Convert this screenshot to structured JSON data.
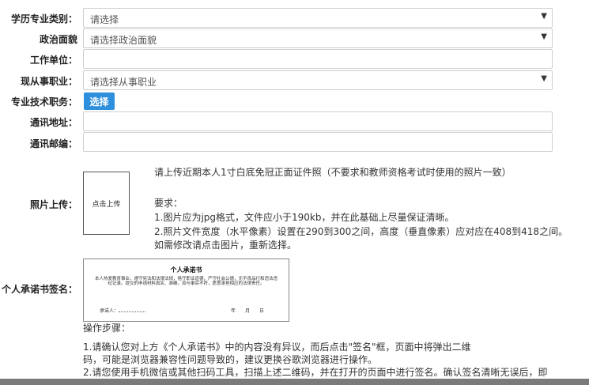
{
  "form": {
    "education_label": "学历专业类别：",
    "education_value": "请选择",
    "political_label": "政治面貌",
    "political_value": "请选择政治面貌",
    "workplace_label": "工作单位：",
    "workplace_value": "",
    "occupation_label": "现从事职业：",
    "occupation_value": "请选择从事职业",
    "title_label": "专业技术职务：",
    "title_button": "选择",
    "address_label": "通讯地址：",
    "address_value": "",
    "postcode_label": "通讯邮编：",
    "postcode_value": ""
  },
  "photo": {
    "label": "照片上传：",
    "placeholder": "点击上传",
    "instruction": "请上传近期本人1寸白底免冠正面证件照（不要求和教师资格考试时使用的照片一致）",
    "req_title": "要求：",
    "req_1": "1.图片应为jpg格式，文件应小于190kb，并在此基础上尽量保证清晰。",
    "req_2": "2.照片文件宽度（水平像素）设置在290到300之间，高度（垂直像素）应对应在408到418之间。",
    "req_3": "如需修改请点击图片，重新选择。"
  },
  "signature": {
    "label": "个人承诺书签名：",
    "doc_title": "个人承诺书",
    "doc_body": "本人热爱教育事业，遵守宪法和法律法规，恪守职业道德，严守社会公德，无不良品行和违法违纪记录。提交的申请材料真实、准确，如与事实不符，愿意承担相应的法律责任。",
    "doc_sign": "承诺人：",
    "doc_date": "年　　月　　日",
    "steps_title": "操作步骤：",
    "step_1a": "1.请确认您对上方《个人承诺书》中的内容没有异议，而后点击\"签名\"框，页面中将弹出二维",
    "step_1b": "码，可能是浏览器兼容性问题导致的，建议更换谷歌浏览器进行操作。",
    "step_2": "2.请您使用手机微信或其他扫码工具，扫描上述二维码，并在打开的页面中进行签名。确认签名清晰无误后，即"
  },
  "icons": {
    "dropdown": "caret-down-icon"
  }
}
